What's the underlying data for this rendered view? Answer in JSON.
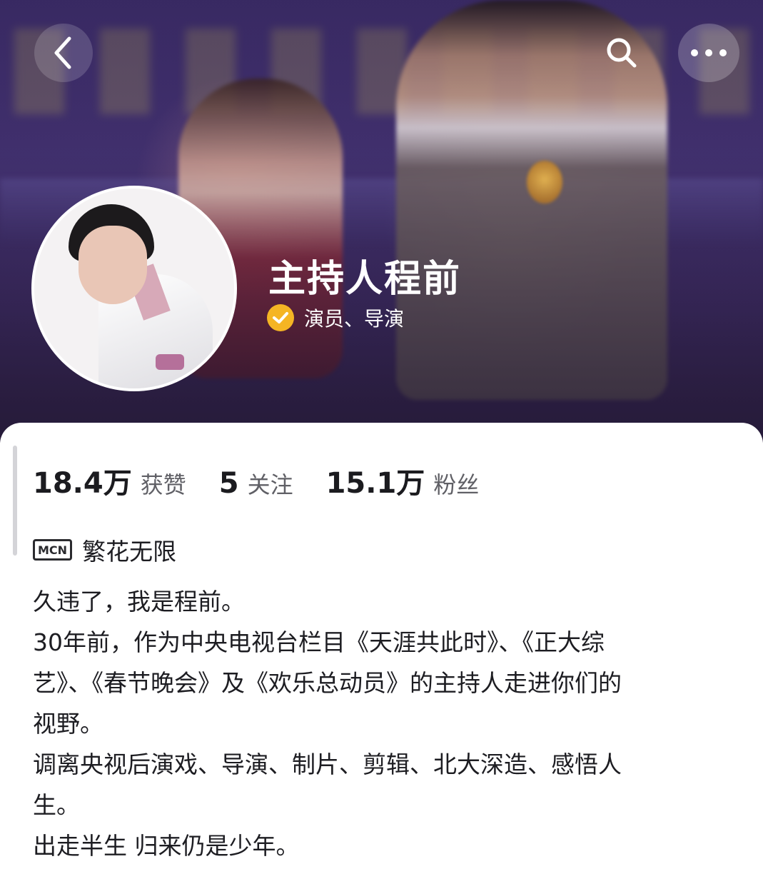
{
  "header": {
    "name": "主持人程前",
    "verification": "演员、导演",
    "icons": {
      "back": "chevron-left-icon",
      "search": "search-icon",
      "more": "more-dots-icon",
      "verified": "check-badge-icon"
    },
    "colors": {
      "banner": "#3d2d6b",
      "verified_badge": "#f5b524"
    }
  },
  "stats": [
    {
      "value": "18.4万",
      "label": "获赞"
    },
    {
      "value": "5",
      "label": "关注"
    },
    {
      "value": "15.1万",
      "label": "粉丝"
    }
  ],
  "mcn": {
    "logo_text": "MCN",
    "name": "繁花无限"
  },
  "bio": {
    "lines": [
      "久违了，我是程前。",
      "30年前，作为中央电视台栏目《天涯共此时》、《正大综",
      "艺》、《春节晚会》及《欢乐总动员》的主持人走进你们的",
      "视野。",
      "调离央视后演戏、导演、制片、剪辑、北大深造、感悟人",
      "生。",
      "出走半生 归来仍是少年。"
    ]
  }
}
